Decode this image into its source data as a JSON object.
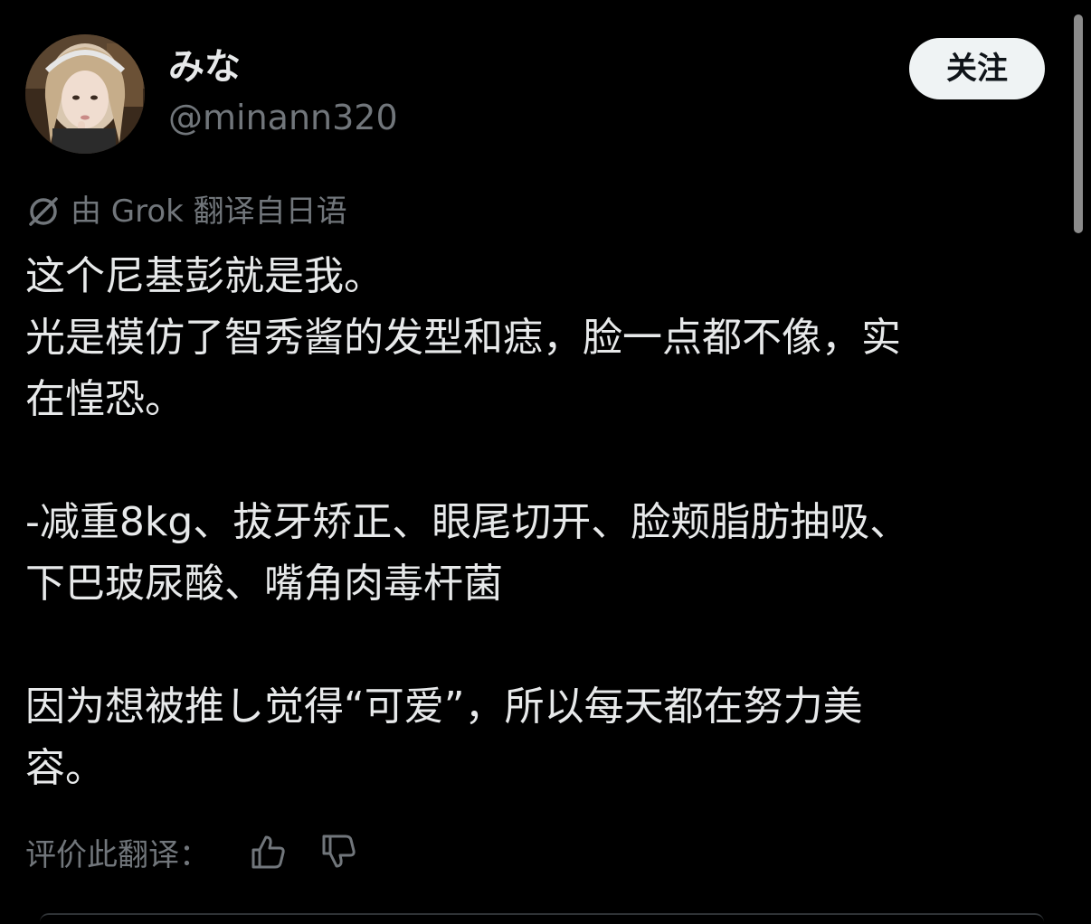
{
  "user": {
    "display_name": "みな",
    "handle": "@minann320"
  },
  "follow_button": {
    "label": "关注"
  },
  "translation": {
    "note": "由 Grok 翻译自日语",
    "icon": "grok-icon"
  },
  "tweet": {
    "lines": [
      "这个尼基彭就是我。",
      "光是模仿了智秀酱的发型和痣，脸一点都不像，实",
      "在惶恐。",
      "",
      "-减重8kg、拔牙矫正、眼尾切开、脸颊脂肪抽吸、",
      "下巴玻尿酸、嘴角肉毒杆菌",
      "",
      "因为想被推し觉得“可爱”，所以每天都在努力美",
      "容。"
    ]
  },
  "rating": {
    "label": "评价此翻译：",
    "icons": [
      "thumbs-up-icon",
      "thumbs-down-icon"
    ]
  },
  "colors": {
    "background": "#000000",
    "text_primary": "#e7e9ea",
    "text_secondary": "#71767b",
    "button_bg": "#eff3f4",
    "button_text": "#0f1419"
  }
}
